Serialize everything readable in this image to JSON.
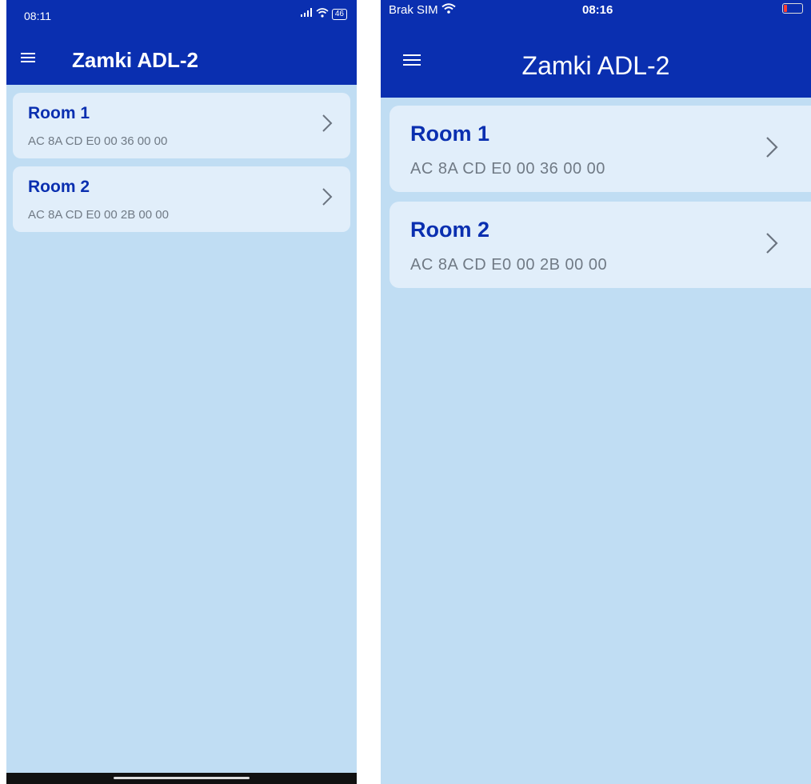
{
  "android": {
    "status": {
      "time": "08:11",
      "battery": "46"
    },
    "app": {
      "title": "Zamki ADL-2"
    },
    "rooms": [
      {
        "name": "Room 1",
        "address": "AC 8A CD E0 00 36 00 00"
      },
      {
        "name": "Room 2",
        "address": "AC 8A CD E0 00 2B 00 00"
      }
    ]
  },
  "ios": {
    "status": {
      "carrier": "Brak SIM",
      "time": "08:16"
    },
    "app": {
      "title": "Zamki ADL-2"
    },
    "rooms": [
      {
        "name": "Room 1",
        "address": "AC 8A CD E0 00 36 00 00"
      },
      {
        "name": "Room 2",
        "address": "AC 8A CD E0 00 2B 00 00"
      }
    ]
  },
  "colors": {
    "primary": "#0a2fb0",
    "background": "#c0ddf3",
    "card": "#e1eefa",
    "secondary_text": "#707a85"
  },
  "icons": [
    "menu-icon",
    "chevron-right-icon",
    "wifi-icon",
    "signal-icon",
    "battery-icon"
  ]
}
